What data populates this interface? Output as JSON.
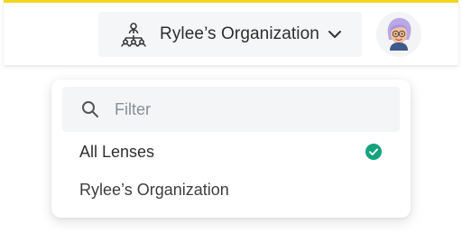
{
  "header": {
    "org_switcher": {
      "label": "Rylee’s Organization",
      "icon": "org-hierarchy-icon",
      "chevron": "chevron-down-icon"
    },
    "avatar": {
      "icon": "user-avatar"
    },
    "accent_color": "#f2d51f"
  },
  "dropdown": {
    "filter": {
      "placeholder": "Filter",
      "value": "",
      "icon": "search-icon"
    },
    "options": [
      {
        "label": "All Lenses",
        "selected": true,
        "icon": "check-circle-icon"
      },
      {
        "label": "Rylee’s Organization",
        "selected": false
      }
    ],
    "check_color": "#14a37f"
  }
}
